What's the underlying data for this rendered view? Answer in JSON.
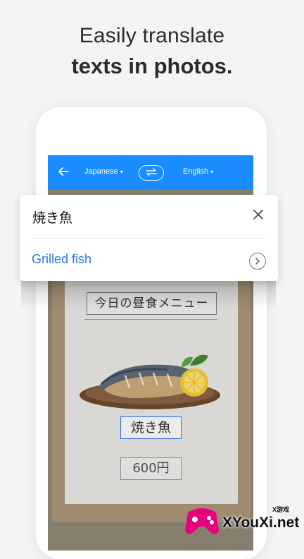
{
  "headline": {
    "line1": "Easily translate",
    "line2": "texts in photos."
  },
  "app": {
    "source_language": "Japanese",
    "target_language": "English",
    "icons": {
      "back": "arrow-left-icon",
      "swap": "swap-icon",
      "caret": "chevron-down-icon"
    }
  },
  "photo": {
    "menu_title": "今日の昼食メニュー",
    "dish_label": "焼き魚",
    "price": "600円"
  },
  "card": {
    "source_text": "焼き魚",
    "translation": "Grilled fish",
    "icons": {
      "close": "close-icon",
      "more": "chevron-right-circle-icon"
    }
  },
  "watermark": {
    "small": "X游戏",
    "big": "XYouXi.net"
  },
  "colors": {
    "accent": "#1a8cff",
    "translation_text": "#2a78e4",
    "background": "#f3f4f6"
  }
}
